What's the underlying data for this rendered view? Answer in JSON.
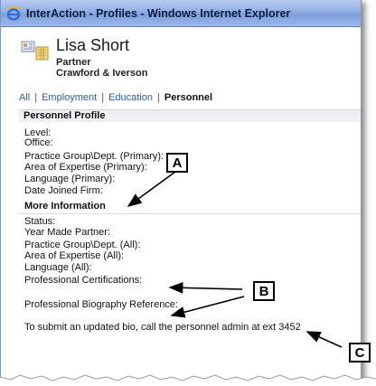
{
  "window": {
    "title": "InterAction - Profiles - Windows Internet Explorer"
  },
  "profile": {
    "name": "Lisa Short",
    "title": "Partner",
    "company": "Crawford & Iverson"
  },
  "tabs": {
    "items": [
      {
        "label": "All"
      },
      {
        "label": "Employment"
      },
      {
        "label": "Education"
      }
    ],
    "separator": "|",
    "active": "Personnel"
  },
  "personnel_profile": {
    "header": "Personnel Profile",
    "fields": [
      "Level:",
      "Office:",
      "Practice Group\\Dept. (Primary):",
      "Area of Expertise (Primary):",
      "Language (Primary):",
      "Date Joined Firm:"
    ]
  },
  "more_information": {
    "header": "More Information",
    "fields": [
      "Status:",
      "Year Made Partner:",
      "Practice Group\\Dept. (All):",
      "Area of Expertise (All):",
      "Language (All):",
      "Professional Certifications:"
    ],
    "biography_label": "Professional Biography Reference:",
    "note": "To submit an updated bio, call the personnel admin at ext 3452"
  },
  "callouts": [
    "A",
    "B",
    "C"
  ],
  "colors": {
    "link": "#2a5ea8",
    "titlebar": "#8faee3"
  }
}
